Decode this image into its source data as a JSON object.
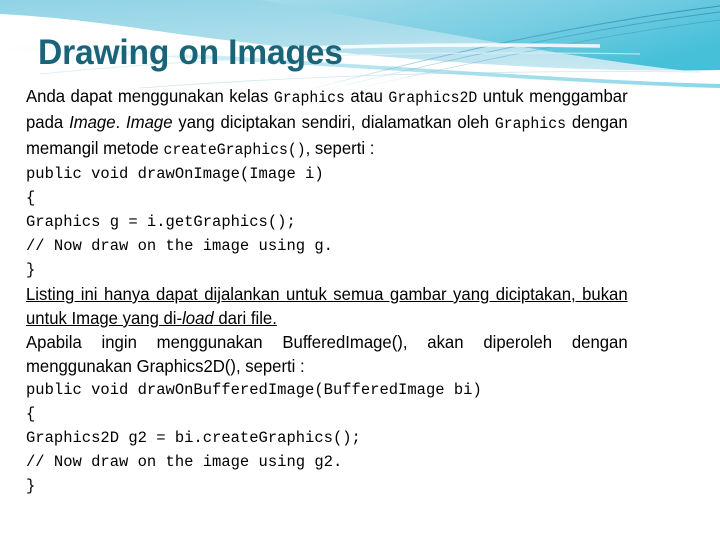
{
  "slide": {
    "title": "Drawing on Images",
    "title_color": "#1a6479",
    "background_color": "#ffffff"
  },
  "banner": {
    "name": "decorative-wave-banner",
    "gradient_start": "#a7dcea",
    "gradient_end": "#4fc3dc",
    "accent_line_color": "#4a9fc4",
    "wave_color": "#ffffff"
  },
  "body": {
    "paragraph_1": {
      "s1": "Anda dapat menggunakan kelas ",
      "code1": "Graphics",
      "s2": " atau ",
      "code2": "Graphics2D",
      "s3": " untuk menggambar pada ",
      "ital1": "Image",
      "s4": ". ",
      "ital2": "Image",
      "s5": " yang diciptakan sendiri, dialamatkan oleh ",
      "code3": "Graphics",
      "s6": " dengan memangil metode ",
      "code4": "createGraphics()",
      "s7": ", seperti :"
    },
    "code_block_1": [
      "public void drawOnImage(Image i)",
      "{",
      "Graphics g = i.getGraphics();",
      "// Now draw on the image using g.",
      "}"
    ],
    "paragraph_2": {
      "s1": "Listing ini hanya dapat dijalankan untuk semua gambar yang diciptakan, bukan untuk Image yang di-",
      "ital1": "load",
      "s2": " dari file."
    },
    "paragraph_3": {
      "s1": "Apabila ingin menggunakan BufferedImage(), akan diperoleh dengan menggunakan Graphics2D(), seperti :"
    },
    "code_block_2": [
      "public void drawOnBufferedImage(BufferedImage bi)",
      "{",
      "Graphics2D g2 = bi.createGraphics();",
      "// Now draw on the image using g2.",
      "}"
    ]
  }
}
